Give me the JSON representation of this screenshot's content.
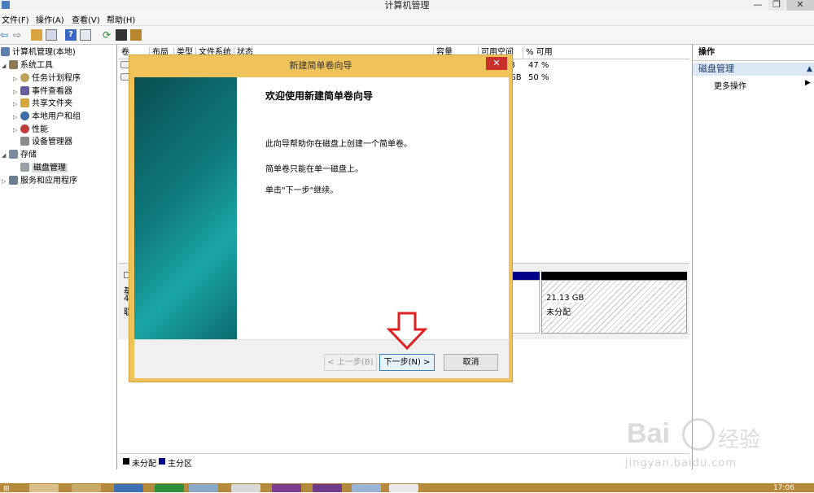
{
  "window": {
    "title": "计算机管理"
  },
  "menu": [
    "文件(F)",
    "操作(A)",
    "查看(V)",
    "帮助(H)"
  ],
  "tree": {
    "root": "计算机管理(本地)",
    "system_tools": "系统工具",
    "items": [
      "任务计划程序",
      "事件查看器",
      "共享文件夹",
      "本地用户和组",
      "性能",
      "设备管理器"
    ],
    "storage": "存储",
    "disk_mgmt": "磁盘管理",
    "services": "服务和应用程序"
  },
  "volumes": {
    "columns": [
      "卷",
      "布局",
      "类型",
      "文件系统",
      "状态",
      "容量",
      "可用空间",
      "% 可用"
    ],
    "rows": [
      {
        "free_suffix": "B",
        "pct": "47 %"
      },
      {
        "free_suffix": "GB",
        "pct": "50 %"
      }
    ]
  },
  "disk_graph": {
    "left_labels": [
      "基",
      "4",
      "联"
    ],
    "unallocated_size": "21.13 GB",
    "unallocated_label": "未分配"
  },
  "legend": {
    "unallocated": "未分配",
    "primary": "主分区"
  },
  "actions": {
    "header": "操作",
    "selected": "磁盘管理",
    "more": "更多操作"
  },
  "dialog": {
    "title": "新建简单卷向导",
    "heading": "欢迎使用新建简单卷向导",
    "p1": "此向导帮助你在磁盘上创建一个简单卷。",
    "p2": "简单卷只能在单一磁盘上。",
    "p3": "单击\"下一步\"继续。",
    "back": "< 上一步(B)",
    "next": "下一步(N) >",
    "cancel": "取消"
  },
  "watermark": {
    "brand": "Bai",
    "cn": "经验",
    "url": "jingyan.baidu.com"
  },
  "clock": "17:06",
  "colors": {
    "dialog_frame": "#f0c35a",
    "close_btn": "#c9302c",
    "arrow": "#e02020",
    "primary_partition": "#00008b"
  }
}
